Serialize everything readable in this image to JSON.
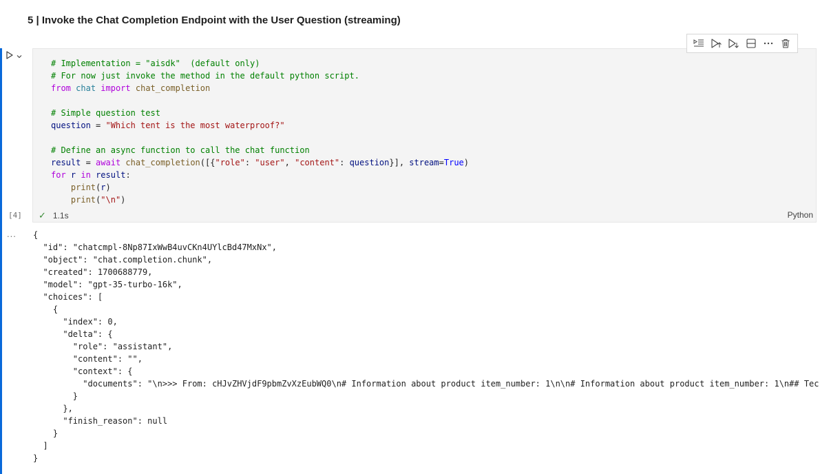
{
  "cell_heading": "5 | Invoke the Chat Completion Endpoint with the User Question (streaming)",
  "toolbar": {
    "items": [
      "run-by-line-icon",
      "execute-above-icon",
      "execute-below-icon",
      "split-cell-icon",
      "more-actions-icon",
      "delete-icon"
    ]
  },
  "code_cell": {
    "execution_count": "[4]",
    "status_time": "1.1s",
    "language": "Python",
    "lines": [
      "# Implementation = \"aisdk\"  (default only)",
      "# For now just invoke the method in the default python script.",
      "from chat import chat_completion",
      "",
      "# Simple question test",
      "question = \"Which tent is the most waterproof?\"",
      "",
      "# Define an async function to call the chat function",
      "result = await chat_completion([{\"role\": \"user\", \"content\": question}], stream=True)",
      "for r in result:",
      "    print(r)",
      "    print(\"\\n\")"
    ]
  },
  "output": {
    "ellipsis": "...",
    "lines": [
      "{",
      "  \"id\": \"chatcmpl-8Np87IxWwB4uvCKn4UYlcBd47MxNx\",",
      "  \"object\": \"chat.completion.chunk\",",
      "  \"created\": 1700688779,",
      "  \"model\": \"gpt-35-turbo-16k\",",
      "  \"choices\": [",
      "    {",
      "      \"index\": 0,",
      "      \"delta\": {",
      "        \"role\": \"assistant\",",
      "        \"content\": \"\",",
      "        \"context\": {",
      "          \"documents\": \"\\n>>> From: cHJvZHVjdF9pbmZvXzEubWQ0\\n# Information about product item_number: 1\\n\\n# Information about product item_number: 1\\n## Tec",
      "        }",
      "      },",
      "      \"finish_reason\": null",
      "    }",
      "  ]",
      "}"
    ]
  }
}
